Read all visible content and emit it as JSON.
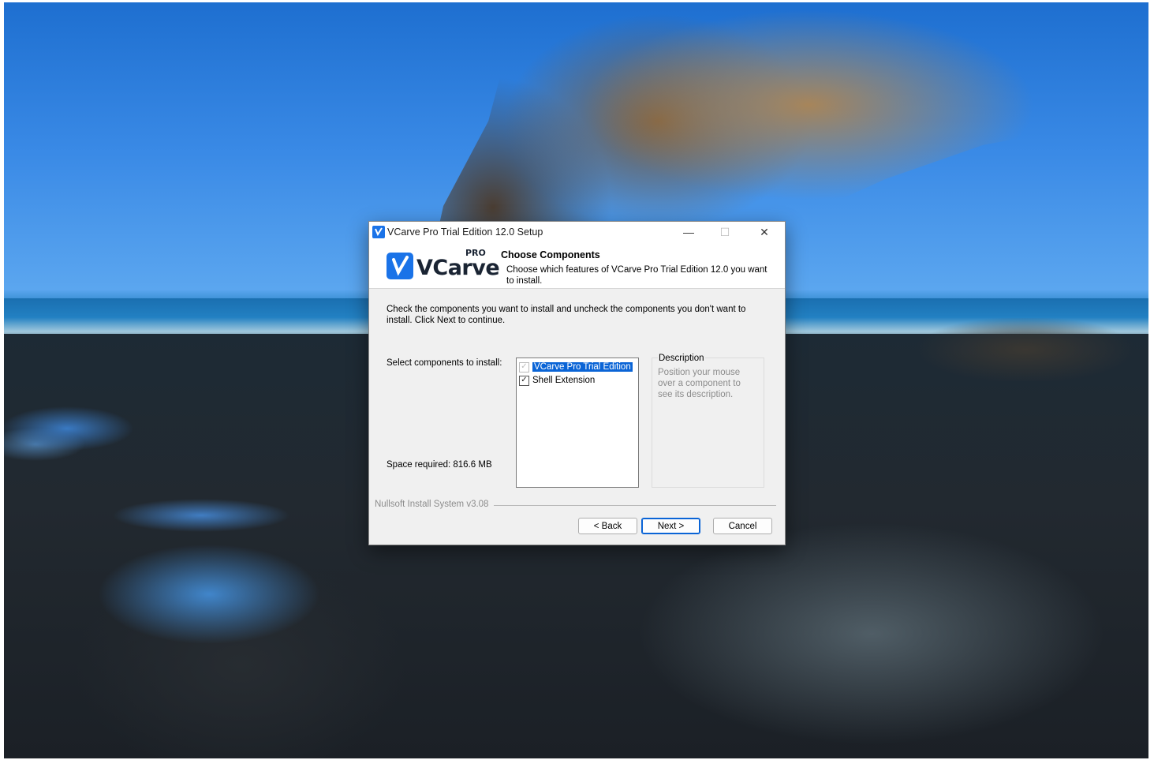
{
  "window": {
    "title": "VCarve Pro Trial Edition 12.0 Setup",
    "controls": {
      "minimize": "—",
      "maximize": "☐",
      "close": "✕"
    }
  },
  "header": {
    "logo_word": "VCarve",
    "logo_badge": "PRO",
    "title": "Choose Components",
    "subtitle": "Choose which features of VCarve Pro Trial Edition 12.0 you want to install."
  },
  "body": {
    "instructions": "Check the components you want to install and uncheck the components you don't want to install. Click Next to continue.",
    "select_label": "Select components to install:",
    "space_required": "Space required: 816.6 MB",
    "components": [
      {
        "label": "VCarve Pro Trial Edition",
        "checked": true,
        "disabled": true,
        "selected": true
      },
      {
        "label": "Shell Extension",
        "checked": true,
        "disabled": false,
        "selected": false
      }
    ],
    "description": {
      "title": "Description",
      "text": "Position your mouse over a component to see its description."
    }
  },
  "footer": {
    "branding": "Nullsoft Install System v3.08",
    "back_label": "< Back",
    "next_label": "Next >",
    "cancel_label": "Cancel"
  },
  "colors": {
    "accent": "#0a64d6",
    "logo_blue": "#1a73e8"
  }
}
